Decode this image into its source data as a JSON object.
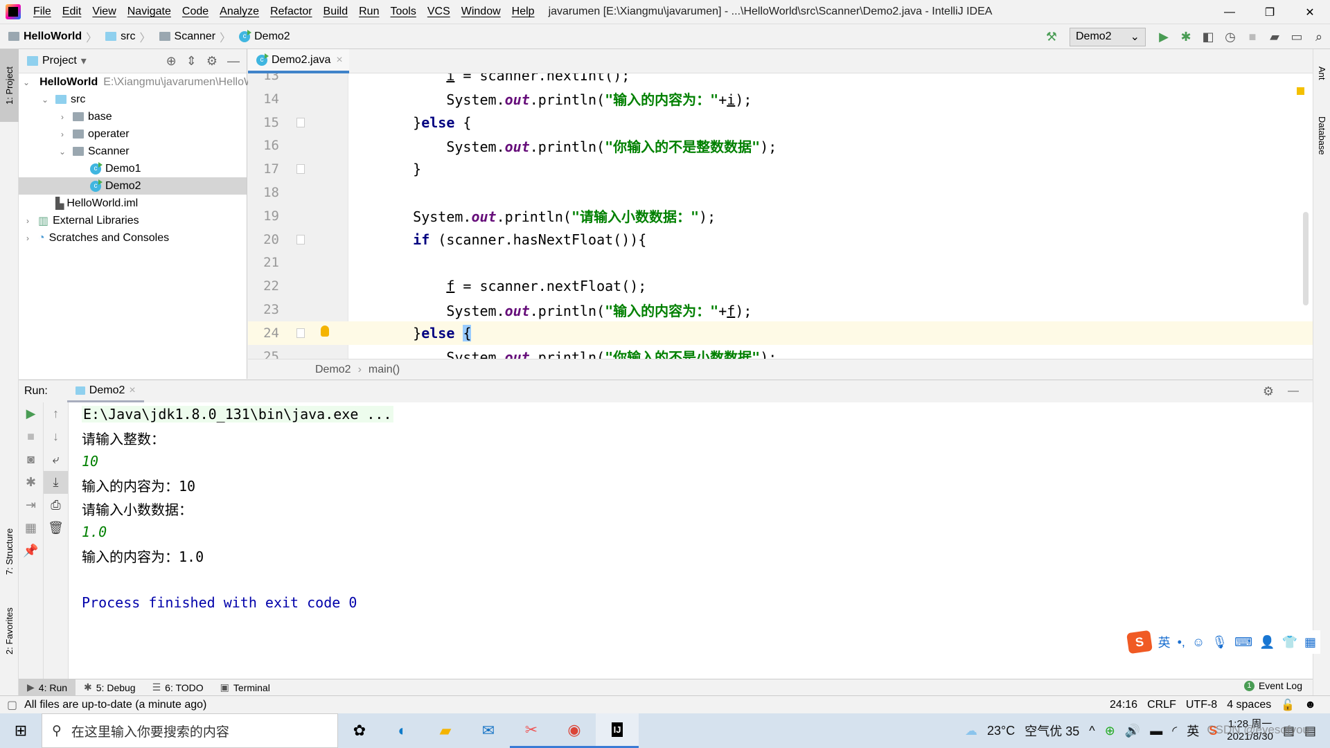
{
  "window": {
    "title": "javarumen [E:\\Xiangmu\\javarumen] - ...\\HelloWorld\\src\\Scanner\\Demo2.java - IntelliJ IDEA",
    "controls": [
      "—",
      "❐",
      "✕"
    ]
  },
  "menu": [
    "File",
    "Edit",
    "View",
    "Navigate",
    "Code",
    "Analyze",
    "Refactor",
    "Build",
    "Run",
    "Tools",
    "VCS",
    "Window",
    "Help"
  ],
  "breadcrumb": [
    "HelloWorld",
    "src",
    "Scanner",
    "Demo2"
  ],
  "toolbar": {
    "run_config": "Demo2"
  },
  "stripes": {
    "left_top": "1: Project",
    "left_structure": "7: Structure",
    "left_favorites": "2: Favorites",
    "right_ant": "Ant",
    "right_database": "Database"
  },
  "project": {
    "title": "Project",
    "tree": [
      {
        "label": "HelloWorld",
        "path": "E:\\Xiangmu\\javarumen\\HelloWorld",
        "arrow": "v",
        "depth": 0,
        "icon": "module",
        "bold": true
      },
      {
        "label": "src",
        "arrow": "v",
        "depth": 1,
        "icon": "src-folder"
      },
      {
        "label": "base",
        "arrow": ">",
        "depth": 2,
        "icon": "package"
      },
      {
        "label": "operater",
        "arrow": ">",
        "depth": 2,
        "icon": "package"
      },
      {
        "label": "Scanner",
        "arrow": "v",
        "depth": 2,
        "icon": "package"
      },
      {
        "label": "Demo1",
        "arrow": "",
        "depth": 3,
        "icon": "class"
      },
      {
        "label": "Demo2",
        "arrow": "",
        "depth": 3,
        "icon": "class",
        "selected": true
      },
      {
        "label": "HelloWorld.iml",
        "arrow": "",
        "depth": 1,
        "icon": "iml"
      },
      {
        "label": "External Libraries",
        "arrow": ">",
        "depth": 0,
        "icon": "library"
      },
      {
        "label": "Scratches and Consoles",
        "arrow": ">",
        "depth": 0,
        "icon": "scratches"
      }
    ]
  },
  "editor": {
    "tab": "Demo2.java",
    "lines": [
      {
        "n": "13",
        "tokens": [
          [
            "        "
          ],
          [
            "i",
            "ul"
          ],
          [
            " = scanner.nextInt();"
          ]
        ]
      },
      {
        "n": "14",
        "tokens": [
          [
            "        System."
          ],
          [
            "out",
            "fld"
          ],
          [
            ".println("
          ],
          [
            "\"输入的内容为：\"",
            "st"
          ],
          [
            "+"
          ],
          [
            "i",
            "ul"
          ],
          [
            ");"
          ]
        ]
      },
      {
        "n": "15",
        "fold": true,
        "tokens": [
          [
            "    }"
          ],
          [
            "else",
            "kw"
          ],
          [
            " {"
          ]
        ]
      },
      {
        "n": "16",
        "tokens": [
          [
            "        System."
          ],
          [
            "out",
            "fld"
          ],
          [
            ".println("
          ],
          [
            "\"你输入的不是整数数据\"",
            "st"
          ],
          [
            ");"
          ]
        ]
      },
      {
        "n": "17",
        "fold": true,
        "tokens": [
          [
            "    }"
          ]
        ]
      },
      {
        "n": "18",
        "tokens": [
          [
            ""
          ]
        ]
      },
      {
        "n": "19",
        "tokens": [
          [
            "    System."
          ],
          [
            "out",
            "fld"
          ],
          [
            ".println("
          ],
          [
            "\"请输入小数数据：\"",
            "st"
          ],
          [
            ");"
          ]
        ]
      },
      {
        "n": "20",
        "fold": true,
        "tokens": [
          [
            "    "
          ],
          [
            "if",
            "kw"
          ],
          [
            " (scanner.hasNextFloat()){"
          ]
        ]
      },
      {
        "n": "21",
        "tokens": [
          [
            ""
          ]
        ]
      },
      {
        "n": "22",
        "tokens": [
          [
            "        "
          ],
          [
            "f",
            "ul"
          ],
          [
            " = scanner.nextFloat();"
          ]
        ]
      },
      {
        "n": "23",
        "tokens": [
          [
            "        System."
          ],
          [
            "out",
            "fld"
          ],
          [
            ".println("
          ],
          [
            "\"输入的内容为：\"",
            "st"
          ],
          [
            "+"
          ],
          [
            "f",
            "ul"
          ],
          [
            ");"
          ]
        ]
      },
      {
        "n": "24",
        "fold": true,
        "current": true,
        "bulb": true,
        "tokens": [
          [
            "    }"
          ],
          [
            "else",
            "kw"
          ],
          [
            " "
          ],
          [
            "{",
            "br"
          ]
        ]
      },
      {
        "n": "25",
        "tokens": [
          [
            "        System."
          ],
          [
            "out",
            "fld"
          ],
          [
            ".println("
          ],
          [
            "\"你输入的不是小数数据\"",
            "st"
          ],
          [
            ");"
          ]
        ]
      }
    ],
    "breadcrumb": [
      "Demo2",
      "main()"
    ]
  },
  "run": {
    "label": "Run:",
    "tab": "Demo2",
    "output": [
      {
        "text": "E:\\Java\\jdk1.8.0_131\\bin\\java.exe ...",
        "kind": "cmd"
      },
      {
        "text": "请输入整数：",
        "kind": "out"
      },
      {
        "text": "10",
        "kind": "in"
      },
      {
        "text": "输入的内容为：10",
        "kind": "out"
      },
      {
        "text": "请输入小数数据：",
        "kind": "out"
      },
      {
        "text": "1.0",
        "kind": "in"
      },
      {
        "text": "输入的内容为：1.0",
        "kind": "out"
      },
      {
        "text": "",
        "kind": "out"
      },
      {
        "text": "Process finished with exit code 0",
        "kind": "exit"
      }
    ]
  },
  "ime": {
    "lang": "英",
    "punct": "•,"
  },
  "tool_windows": [
    {
      "label": "4: Run",
      "icon": "▶",
      "active": true
    },
    {
      "label": "5: Debug",
      "icon": "✱"
    },
    {
      "label": "6: TODO",
      "icon": "☰"
    },
    {
      "label": "Terminal",
      "icon": "▣"
    }
  ],
  "event_log": {
    "count": "1",
    "label": "Event Log"
  },
  "status": {
    "message": "All files are up-to-date (a minute ago)",
    "position": "24:16",
    "line_sep": "CRLF",
    "encoding": "UTF-8",
    "indent": "4 spaces"
  },
  "taskbar": {
    "search_placeholder": "在这里输入你要搜索的内容",
    "weather": "23°C",
    "air": "空气优 35",
    "ime": "英",
    "time": "1:28 周一",
    "date": "2021/8/30",
    "watermark": "CSDN @eyesofyou"
  }
}
